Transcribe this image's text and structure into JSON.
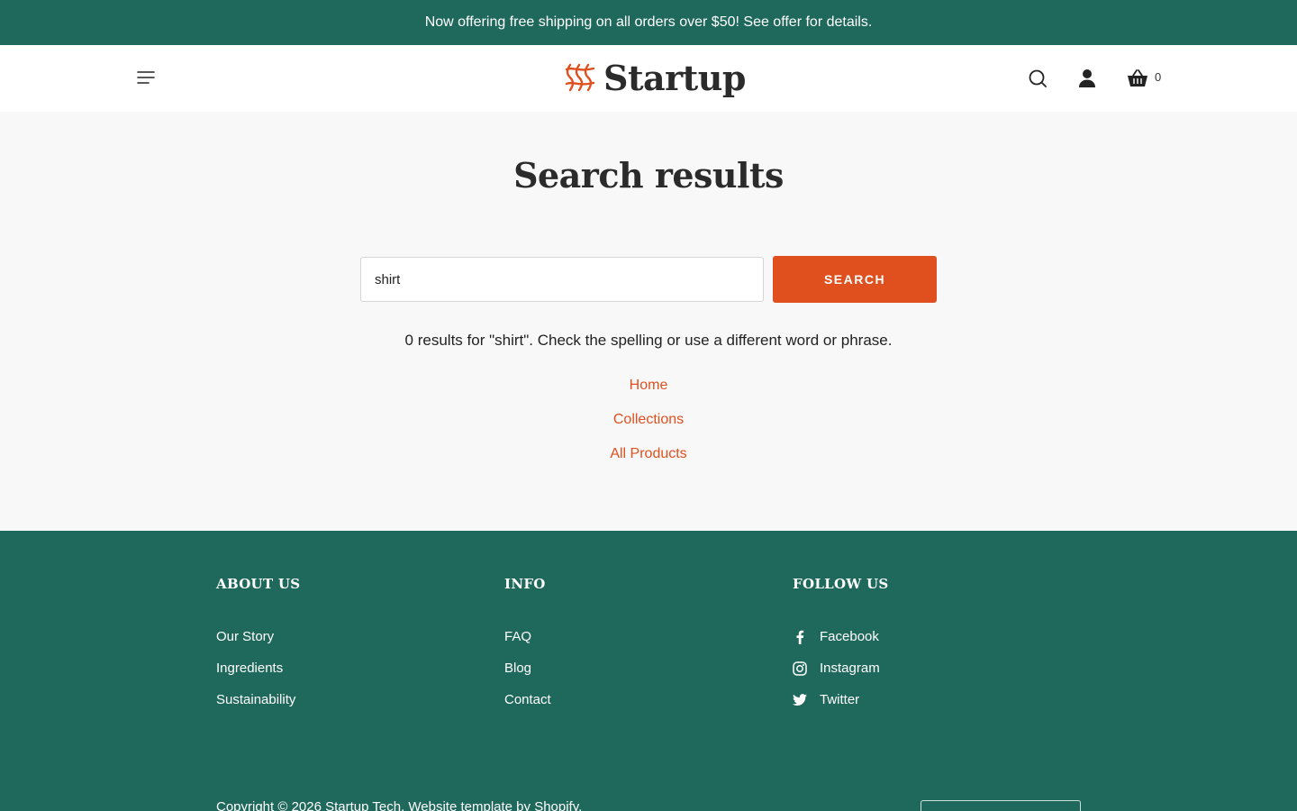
{
  "announcement": "Now offering free shipping on all orders over $50! See offer for details.",
  "header": {
    "brand": "Startup",
    "cart_count": "0"
  },
  "main": {
    "title": "Search results",
    "search": {
      "value": "shirt",
      "button_label": "SEARCH"
    },
    "message": "0 results for \"shirt\". Check the spelling or use a different word or phrase.",
    "links": [
      "Home",
      "Collections",
      "All Products"
    ]
  },
  "footer": {
    "about": {
      "heading": "ABOUT US",
      "items": [
        "Our Story",
        "Ingredients",
        "Sustainability"
      ]
    },
    "info": {
      "heading": "INFO",
      "items": [
        "FAQ",
        "Blog",
        "Contact"
      ]
    },
    "follow": {
      "heading": "FOLLOW US",
      "items": [
        "Facebook",
        "Instagram",
        "Twitter"
      ]
    },
    "copyright": "Copyright © 2026 Startup Tech. Website template by Shopify."
  },
  "colors": {
    "accent": "#e0501f",
    "brand_green": "#1f685c",
    "background": "#f8f8f8"
  }
}
